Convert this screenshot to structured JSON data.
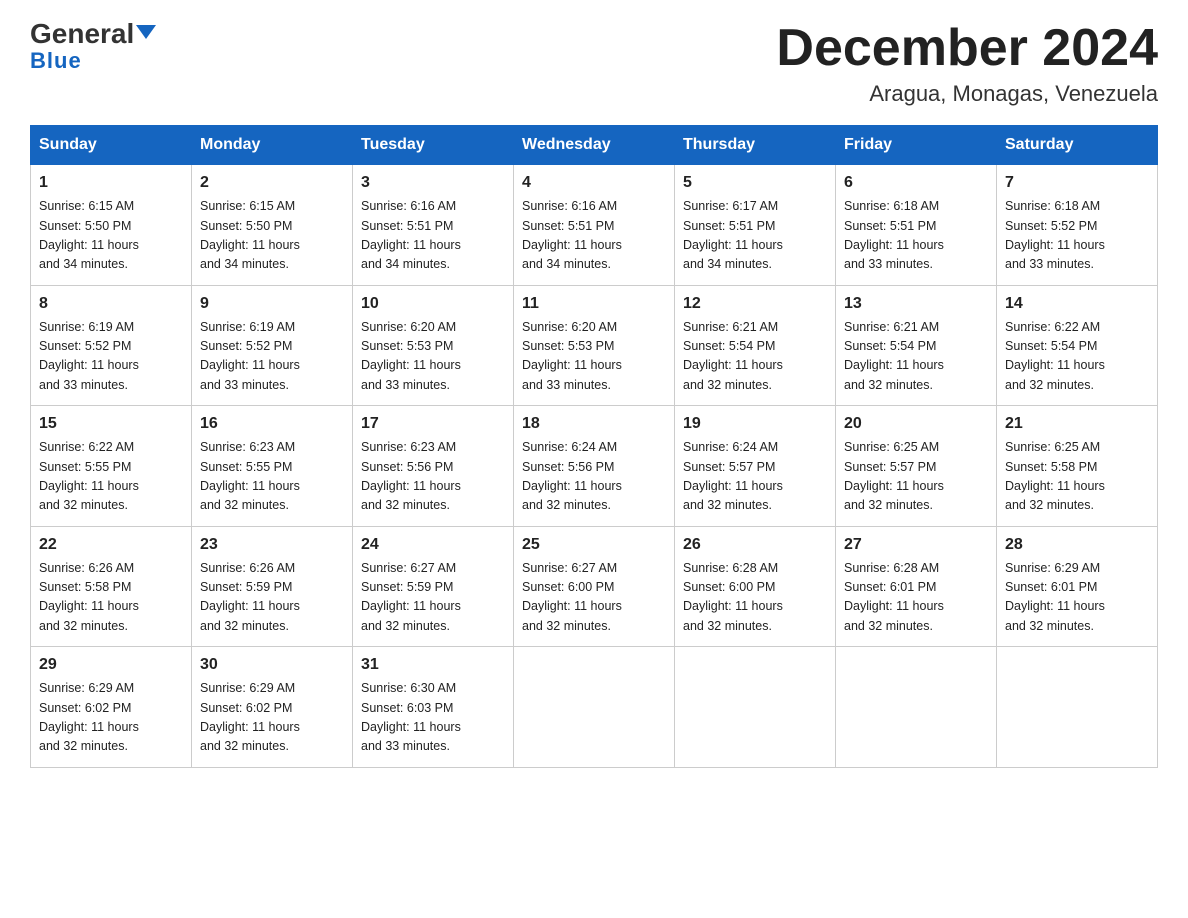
{
  "logo": {
    "general": "General",
    "blue": "Blue"
  },
  "header": {
    "title": "December 2024",
    "subtitle": "Aragua, Monagas, Venezuela"
  },
  "weekdays": [
    "Sunday",
    "Monday",
    "Tuesday",
    "Wednesday",
    "Thursday",
    "Friday",
    "Saturday"
  ],
  "weeks": [
    [
      {
        "day": "1",
        "sunrise": "6:15 AM",
        "sunset": "5:50 PM",
        "daylight": "11 hours and 34 minutes."
      },
      {
        "day": "2",
        "sunrise": "6:15 AM",
        "sunset": "5:50 PM",
        "daylight": "11 hours and 34 minutes."
      },
      {
        "day": "3",
        "sunrise": "6:16 AM",
        "sunset": "5:51 PM",
        "daylight": "11 hours and 34 minutes."
      },
      {
        "day": "4",
        "sunrise": "6:16 AM",
        "sunset": "5:51 PM",
        "daylight": "11 hours and 34 minutes."
      },
      {
        "day": "5",
        "sunrise": "6:17 AM",
        "sunset": "5:51 PM",
        "daylight": "11 hours and 34 minutes."
      },
      {
        "day": "6",
        "sunrise": "6:18 AM",
        "sunset": "5:51 PM",
        "daylight": "11 hours and 33 minutes."
      },
      {
        "day": "7",
        "sunrise": "6:18 AM",
        "sunset": "5:52 PM",
        "daylight": "11 hours and 33 minutes."
      }
    ],
    [
      {
        "day": "8",
        "sunrise": "6:19 AM",
        "sunset": "5:52 PM",
        "daylight": "11 hours and 33 minutes."
      },
      {
        "day": "9",
        "sunrise": "6:19 AM",
        "sunset": "5:52 PM",
        "daylight": "11 hours and 33 minutes."
      },
      {
        "day": "10",
        "sunrise": "6:20 AM",
        "sunset": "5:53 PM",
        "daylight": "11 hours and 33 minutes."
      },
      {
        "day": "11",
        "sunrise": "6:20 AM",
        "sunset": "5:53 PM",
        "daylight": "11 hours and 33 minutes."
      },
      {
        "day": "12",
        "sunrise": "6:21 AM",
        "sunset": "5:54 PM",
        "daylight": "11 hours and 32 minutes."
      },
      {
        "day": "13",
        "sunrise": "6:21 AM",
        "sunset": "5:54 PM",
        "daylight": "11 hours and 32 minutes."
      },
      {
        "day": "14",
        "sunrise": "6:22 AM",
        "sunset": "5:54 PM",
        "daylight": "11 hours and 32 minutes."
      }
    ],
    [
      {
        "day": "15",
        "sunrise": "6:22 AM",
        "sunset": "5:55 PM",
        "daylight": "11 hours and 32 minutes."
      },
      {
        "day": "16",
        "sunrise": "6:23 AM",
        "sunset": "5:55 PM",
        "daylight": "11 hours and 32 minutes."
      },
      {
        "day": "17",
        "sunrise": "6:23 AM",
        "sunset": "5:56 PM",
        "daylight": "11 hours and 32 minutes."
      },
      {
        "day": "18",
        "sunrise": "6:24 AM",
        "sunset": "5:56 PM",
        "daylight": "11 hours and 32 minutes."
      },
      {
        "day": "19",
        "sunrise": "6:24 AM",
        "sunset": "5:57 PM",
        "daylight": "11 hours and 32 minutes."
      },
      {
        "day": "20",
        "sunrise": "6:25 AM",
        "sunset": "5:57 PM",
        "daylight": "11 hours and 32 minutes."
      },
      {
        "day": "21",
        "sunrise": "6:25 AM",
        "sunset": "5:58 PM",
        "daylight": "11 hours and 32 minutes."
      }
    ],
    [
      {
        "day": "22",
        "sunrise": "6:26 AM",
        "sunset": "5:58 PM",
        "daylight": "11 hours and 32 minutes."
      },
      {
        "day": "23",
        "sunrise": "6:26 AM",
        "sunset": "5:59 PM",
        "daylight": "11 hours and 32 minutes."
      },
      {
        "day": "24",
        "sunrise": "6:27 AM",
        "sunset": "5:59 PM",
        "daylight": "11 hours and 32 minutes."
      },
      {
        "day": "25",
        "sunrise": "6:27 AM",
        "sunset": "6:00 PM",
        "daylight": "11 hours and 32 minutes."
      },
      {
        "day": "26",
        "sunrise": "6:28 AM",
        "sunset": "6:00 PM",
        "daylight": "11 hours and 32 minutes."
      },
      {
        "day": "27",
        "sunrise": "6:28 AM",
        "sunset": "6:01 PM",
        "daylight": "11 hours and 32 minutes."
      },
      {
        "day": "28",
        "sunrise": "6:29 AM",
        "sunset": "6:01 PM",
        "daylight": "11 hours and 32 minutes."
      }
    ],
    [
      {
        "day": "29",
        "sunrise": "6:29 AM",
        "sunset": "6:02 PM",
        "daylight": "11 hours and 32 minutes."
      },
      {
        "day": "30",
        "sunrise": "6:29 AM",
        "sunset": "6:02 PM",
        "daylight": "11 hours and 32 minutes."
      },
      {
        "day": "31",
        "sunrise": "6:30 AM",
        "sunset": "6:03 PM",
        "daylight": "11 hours and 33 minutes."
      },
      null,
      null,
      null,
      null
    ]
  ],
  "labels": {
    "sunrise": "Sunrise:",
    "sunset": "Sunset:",
    "daylight": "Daylight:"
  }
}
